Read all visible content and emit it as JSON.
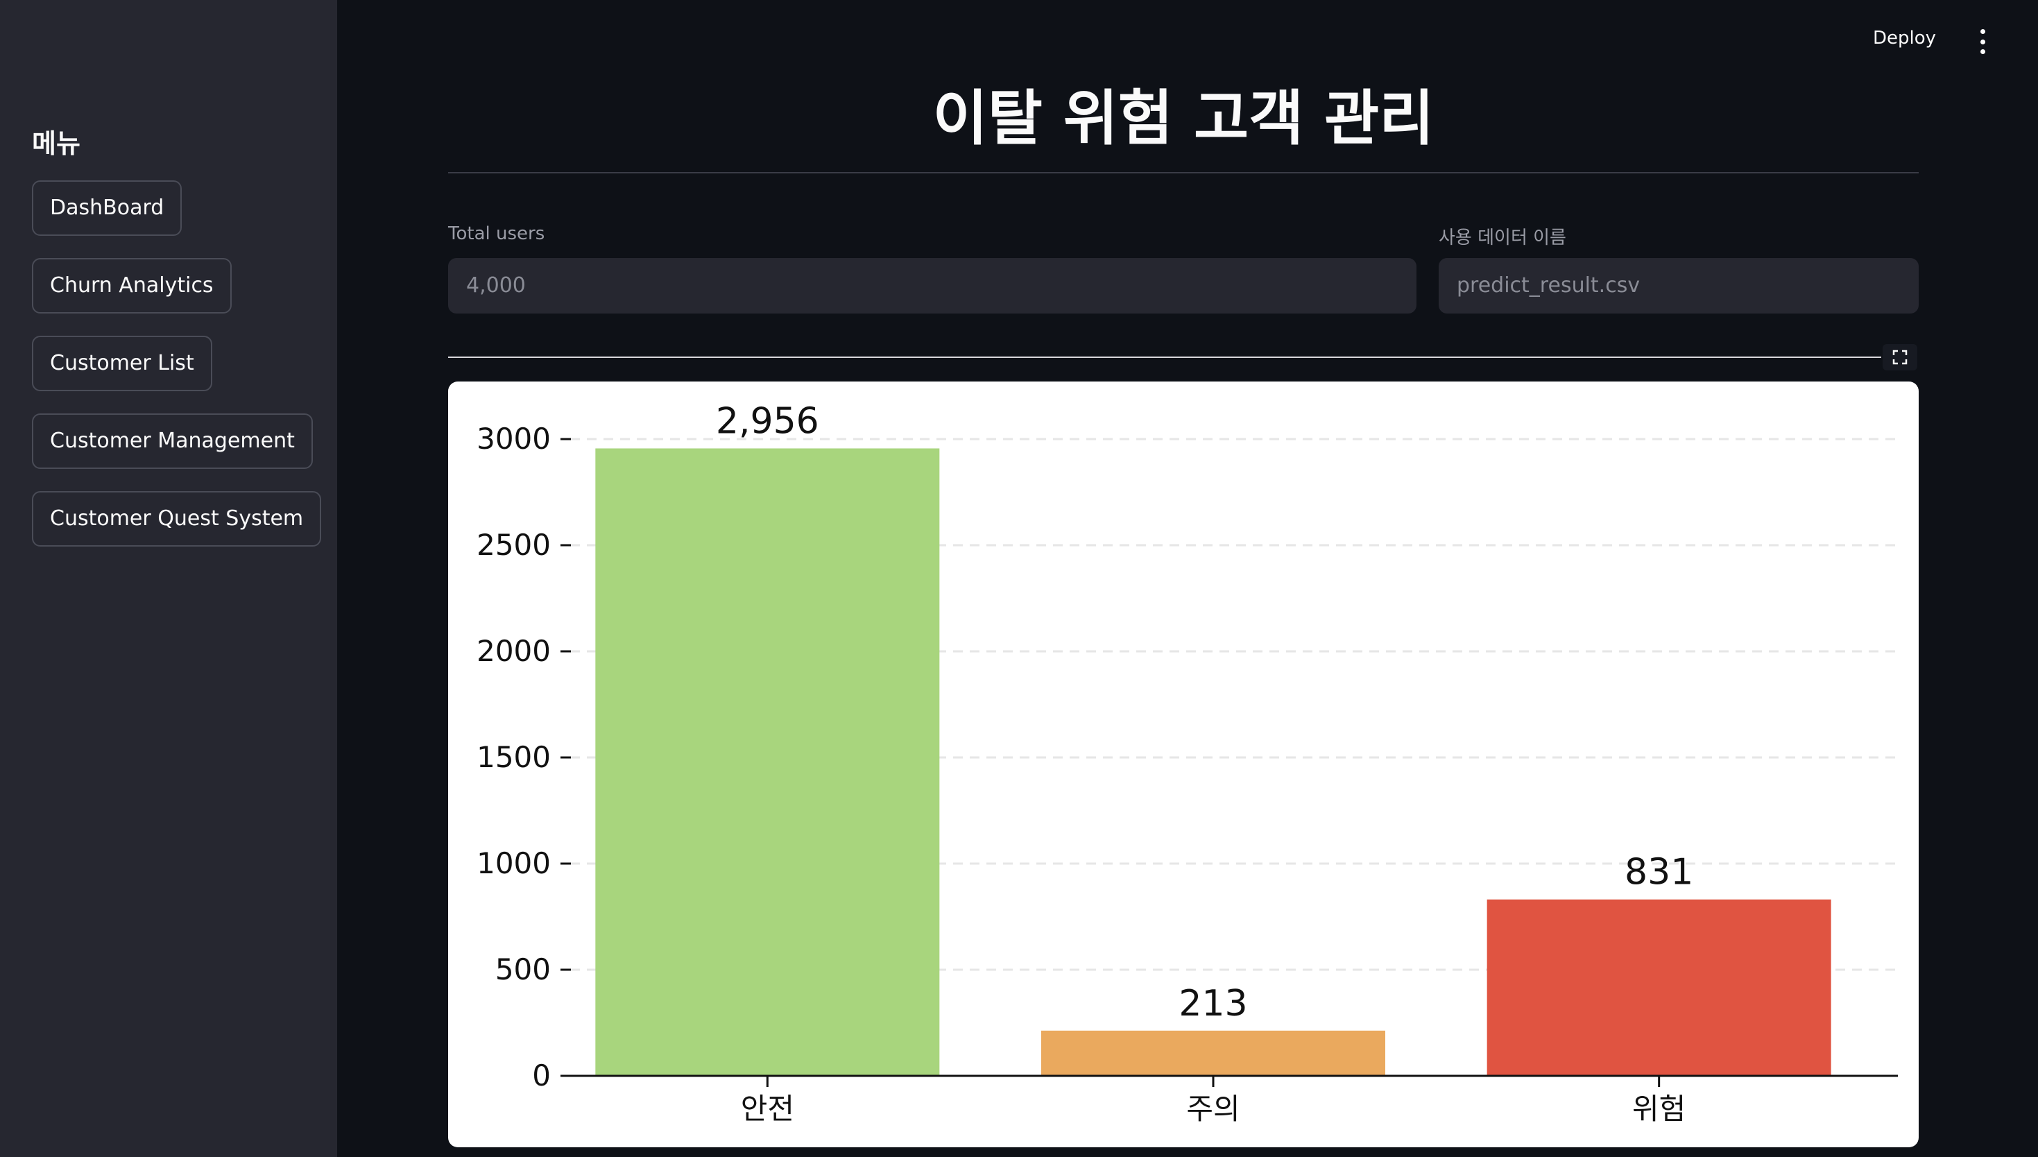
{
  "sidebar": {
    "title": "메뉴",
    "items": [
      {
        "label": "DashBoard"
      },
      {
        "label": "Churn Analytics"
      },
      {
        "label": "Customer List"
      },
      {
        "label": "Customer Management"
      },
      {
        "label": "Customer Quest System"
      }
    ]
  },
  "topbar": {
    "deploy_label": "Deploy",
    "menu_icon": "kebab-menu-icon"
  },
  "main": {
    "title": "이탈 위험 고객 관리",
    "total_users": {
      "label": "Total users",
      "value": "4,000"
    },
    "data_name": {
      "label": "사용 데이터 이름",
      "value": "predict_result.csv"
    },
    "expand_icon": "fullscreen-icon"
  },
  "chart_data": {
    "type": "bar",
    "categories": [
      "안전",
      "주의",
      "위험"
    ],
    "values": [
      2956,
      213,
      831
    ],
    "value_labels": [
      "2,956",
      "213",
      "831"
    ],
    "colors": [
      "#a8d57d",
      "#eaa95e",
      "#e05441"
    ],
    "title": "",
    "xlabel": "",
    "ylabel": "",
    "ylim": [
      0,
      3000
    ],
    "yticks": [
      0,
      500,
      1000,
      1500,
      2000,
      2500,
      3000
    ],
    "ytick_labels": [
      "0",
      "500",
      "1000",
      "1500",
      "2000",
      "2500",
      "3000"
    ],
    "grid": "horizontal dashed",
    "background": "#ffffff"
  }
}
